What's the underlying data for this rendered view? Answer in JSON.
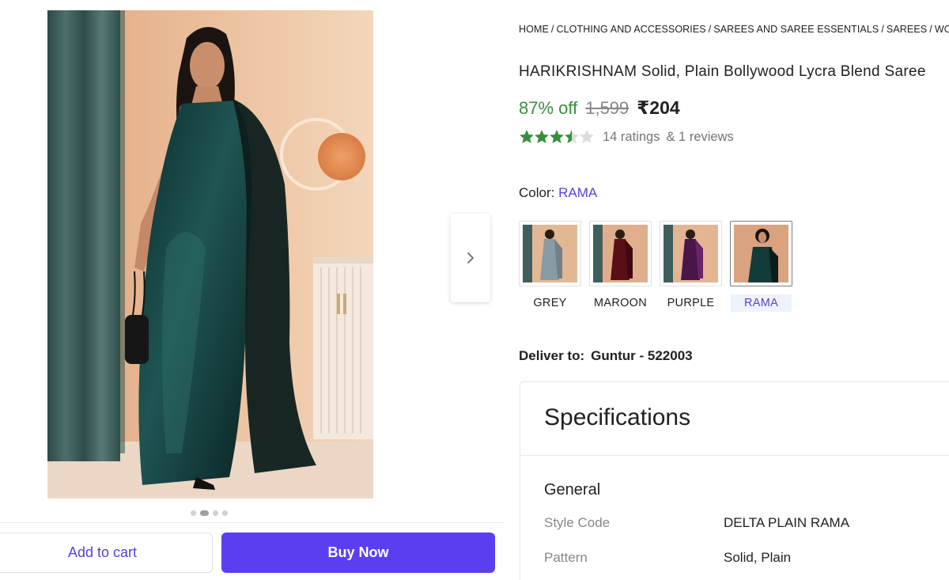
{
  "breadcrumb": {
    "items": [
      "HOME",
      "CLOTHING AND ACCESSORIES",
      "SAREES AND SAREE ESSENTIALS",
      "SAREES",
      "WO"
    ]
  },
  "product": {
    "title": "HARIKRISHNAM Solid, Plain Bollywood Lycra Blend Saree",
    "discount": "87% off",
    "mrp": "1,599",
    "price": "₹204",
    "rating_stars": 3.5,
    "ratings_count": "14 ratings",
    "reviews_count": "& 1 reviews"
  },
  "color": {
    "label": "Color:",
    "selected": "RAMA",
    "options": [
      {
        "name": "GREY",
        "swatch": "#8a9aa3"
      },
      {
        "name": "MAROON",
        "swatch": "#5a0f16"
      },
      {
        "name": "PURPLE",
        "swatch": "#4a1549"
      },
      {
        "name": "RAMA",
        "swatch": "#123b3a"
      }
    ]
  },
  "delivery": {
    "label": "Deliver to:",
    "location": "Guntur - 522003"
  },
  "gallery": {
    "image_count": 4,
    "active_index": 1,
    "next_icon": "chevron-right-icon"
  },
  "actions": {
    "add_to_cart": "Add to cart",
    "buy_now": "Buy Now"
  },
  "specifications": {
    "title": "Specifications",
    "section": "General",
    "rows": [
      {
        "key": "Style Code",
        "value": "DELTA PLAIN RAMA"
      },
      {
        "key": "Pattern",
        "value": "Solid, Plain"
      }
    ]
  },
  "colors": {
    "accent": "#5b3ef0",
    "discount_green": "#388e3c",
    "star_green": "#388e3c"
  }
}
